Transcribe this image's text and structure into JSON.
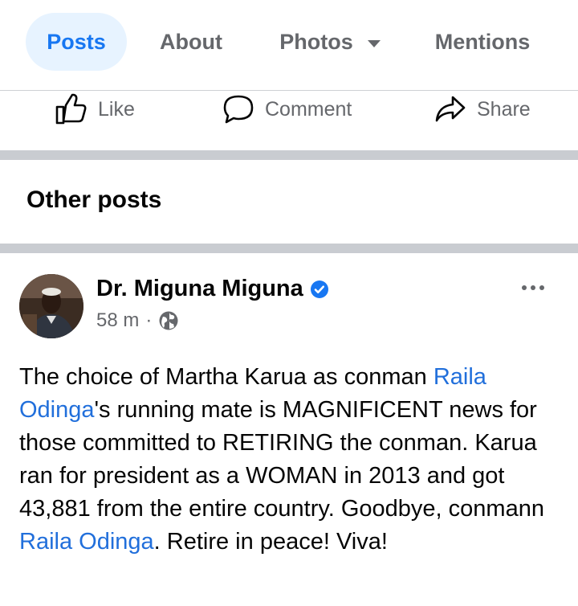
{
  "tabs": [
    {
      "label": "Posts",
      "active": true
    },
    {
      "label": "About"
    },
    {
      "label": "Photos"
    },
    {
      "label": "Mentions"
    }
  ],
  "actions": {
    "like": "Like",
    "comment": "Comment",
    "share": "Share"
  },
  "section_title": "Other posts",
  "post": {
    "author": "Dr. Miguna Miguna",
    "time": "58 m",
    "dot": "·",
    "text": {
      "p1": "The choice of Martha Karua as conman ",
      "link1a": "Raila",
      "link1b": "Odinga",
      "p2": "'s running mate is MAGNIFICENT news for those committed to RETIRING the conman. Karua ran for president as a WOMAN in 2013 and got 43,881 from the entire country. Goodbye, conmann ",
      "link2": "Raila Odinga",
      "p3": ". Retire in peace! Viva!"
    }
  },
  "colors": {
    "accent": "#1877f2",
    "link": "#216fdb",
    "muted": "#65676b",
    "tab_active_bg": "#e7f3ff"
  },
  "icons": [
    "like-icon",
    "comment-icon",
    "share-icon",
    "verified-badge-icon",
    "globe-icon",
    "more-icon",
    "caret-down-icon"
  ]
}
